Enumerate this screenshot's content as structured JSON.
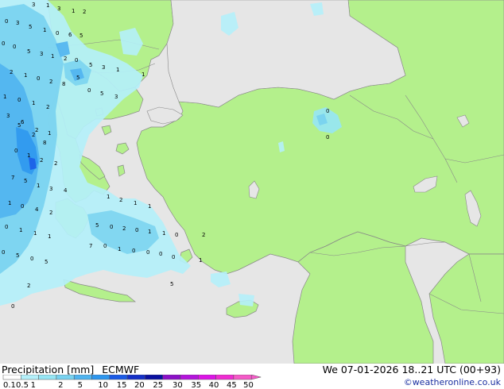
{
  "header": {
    "variable": "Precipitation [mm]",
    "model": "ECMWF",
    "datetime": "We 07-01-2026 18..21 UTC (00+93)",
    "credit": "©weatheronline.co.uk"
  },
  "legend": {
    "labels": [
      "0.1",
      "0.5",
      "1",
      "2",
      "5",
      "10",
      "15",
      "20",
      "25",
      "30",
      "35",
      "40",
      "45",
      "50"
    ],
    "colors": [
      "#ffffff",
      "#b4f0fa",
      "#96e6f5",
      "#78d2f0",
      "#50b4f0",
      "#2d96ee",
      "#1a5ae6",
      "#1430c8",
      "#0a10a0",
      "#8c10c8",
      "#b414dc",
      "#dc14e6",
      "#f02cd2",
      "#f55ac8"
    ]
  },
  "colors": {
    "land": "#b4f08c",
    "outside_land": "#e6e6e6",
    "sea": "#e6e6e6",
    "border": "#888888"
  },
  "map_labels": [
    "3",
    "1",
    "3",
    "1",
    "2",
    "0",
    "3",
    "5",
    "1",
    "0",
    "6",
    "5",
    "0",
    "0",
    "5",
    "3",
    "1",
    "2",
    "0",
    "5",
    "3",
    "1",
    "2",
    "1",
    "0",
    "2",
    "8",
    "5",
    "1",
    "1",
    "0",
    "1",
    "2",
    "0",
    "5",
    "3",
    "3",
    "6",
    "2",
    "1",
    "5",
    "2",
    "8",
    "0",
    "1",
    "2",
    "2",
    "7",
    "5",
    "1",
    "3",
    "4",
    "1",
    "0",
    "4",
    "2",
    "1",
    "2",
    "1",
    "1",
    "0",
    "1",
    "1",
    "1",
    "5",
    "0",
    "2",
    "0",
    "1",
    "1",
    "0",
    "2",
    "0",
    "5",
    "0",
    "5",
    "7",
    "0",
    "1",
    "0",
    "0",
    "0",
    "0",
    "1",
    "2",
    "5",
    "0",
    "0",
    "0"
  ]
}
